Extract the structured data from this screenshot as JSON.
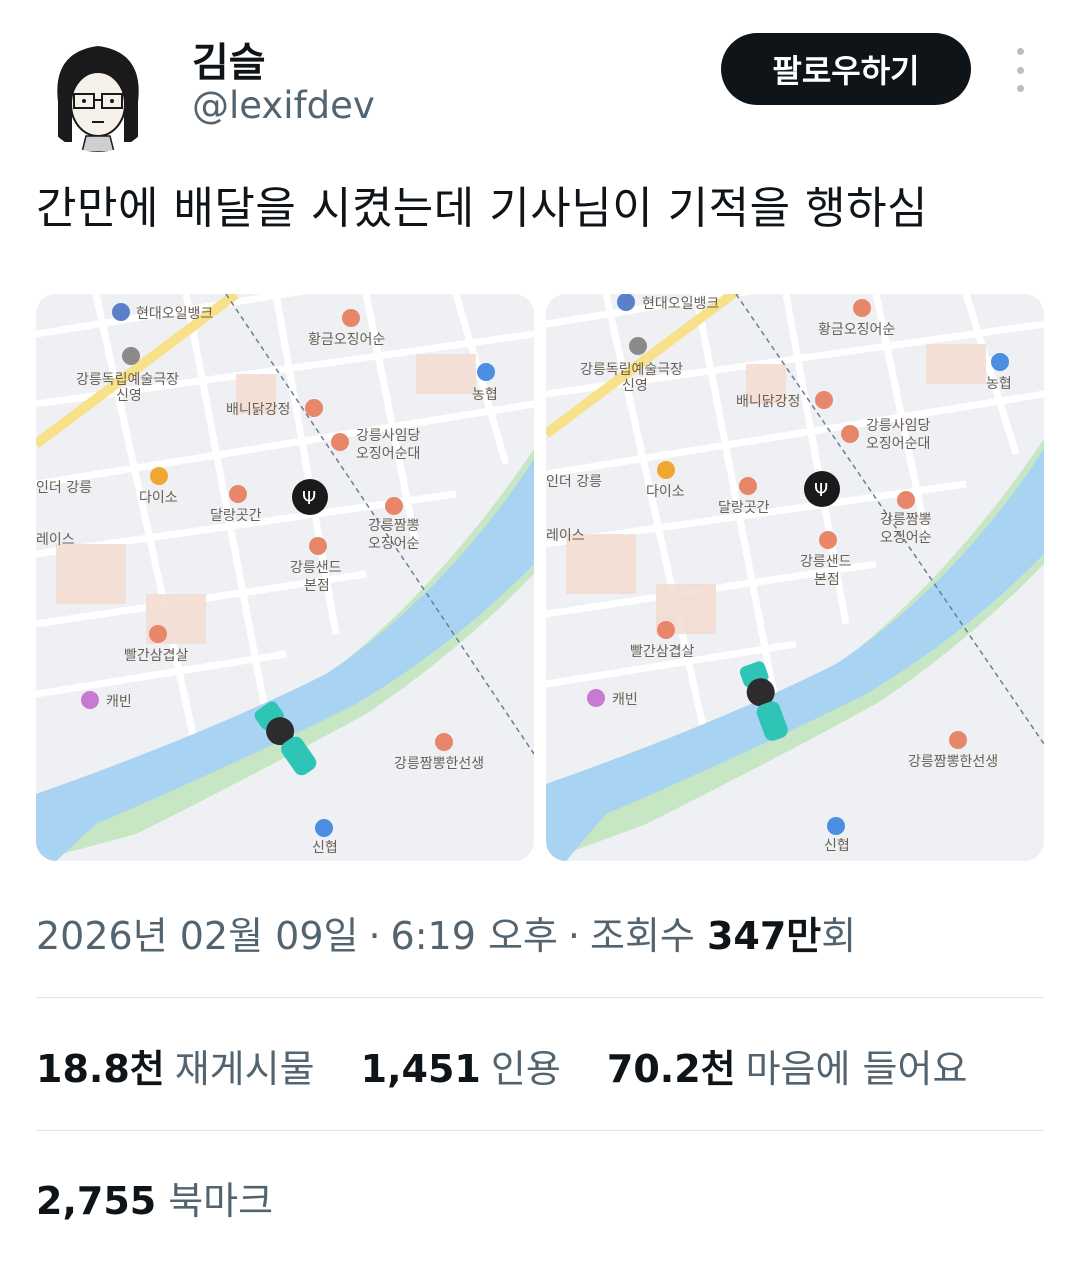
{
  "user": {
    "display_name": "김슬",
    "handle": "@lexifdev"
  },
  "actions": {
    "follow_label": "팔로우하기",
    "more_icon": "more-vertical-icon"
  },
  "tweet": {
    "text": "간만에 배달을 시켰는데 기사님이 기적을 행하심"
  },
  "map_labels": {
    "gas_station": "현대오일뱅크",
    "cinema_line1": "강릉독립예술극장",
    "cinema_line2": "신영",
    "squid": "황금오징어순",
    "bank": "농협",
    "chicken": "배니닭강정",
    "sashimi_line1": "강릉사임당",
    "sashimi_line2": "오징어순대",
    "daiso": "다이소",
    "dalrang": "달랑곳간",
    "jjamppong_line1": "강릉짬뽕",
    "jjamppong_line2": "오징어순",
    "sand_line1": "강릉샌드",
    "sand_line2": "본점",
    "samgyeop": "빨간삼겹살",
    "cabin": "캐빈",
    "jjamppong2": "강릉짬뽕한선생",
    "shinhan": "신협",
    "left_edge1": "인더 강릉",
    "left_edge2": "레이스"
  },
  "meta": {
    "date": "2026년 02월 09일",
    "time": "6:19 오후",
    "views_label": "조회수",
    "views_number": "347만",
    "views_suffix": "회",
    "separator": "·"
  },
  "stats": {
    "reposts_count": "18.8천",
    "reposts_label": "재게시물",
    "quotes_count": "1,451",
    "quotes_label": "인용",
    "likes_count": "70.2천",
    "likes_label": "마음에 들어요",
    "bookmarks_count": "2,755",
    "bookmarks_label": "북마크"
  },
  "colors": {
    "text": "#0f1419",
    "secondary": "#536471",
    "follow_bg": "#0f1419",
    "river": "#a9d3f2",
    "rider": "#2ec4b6"
  }
}
